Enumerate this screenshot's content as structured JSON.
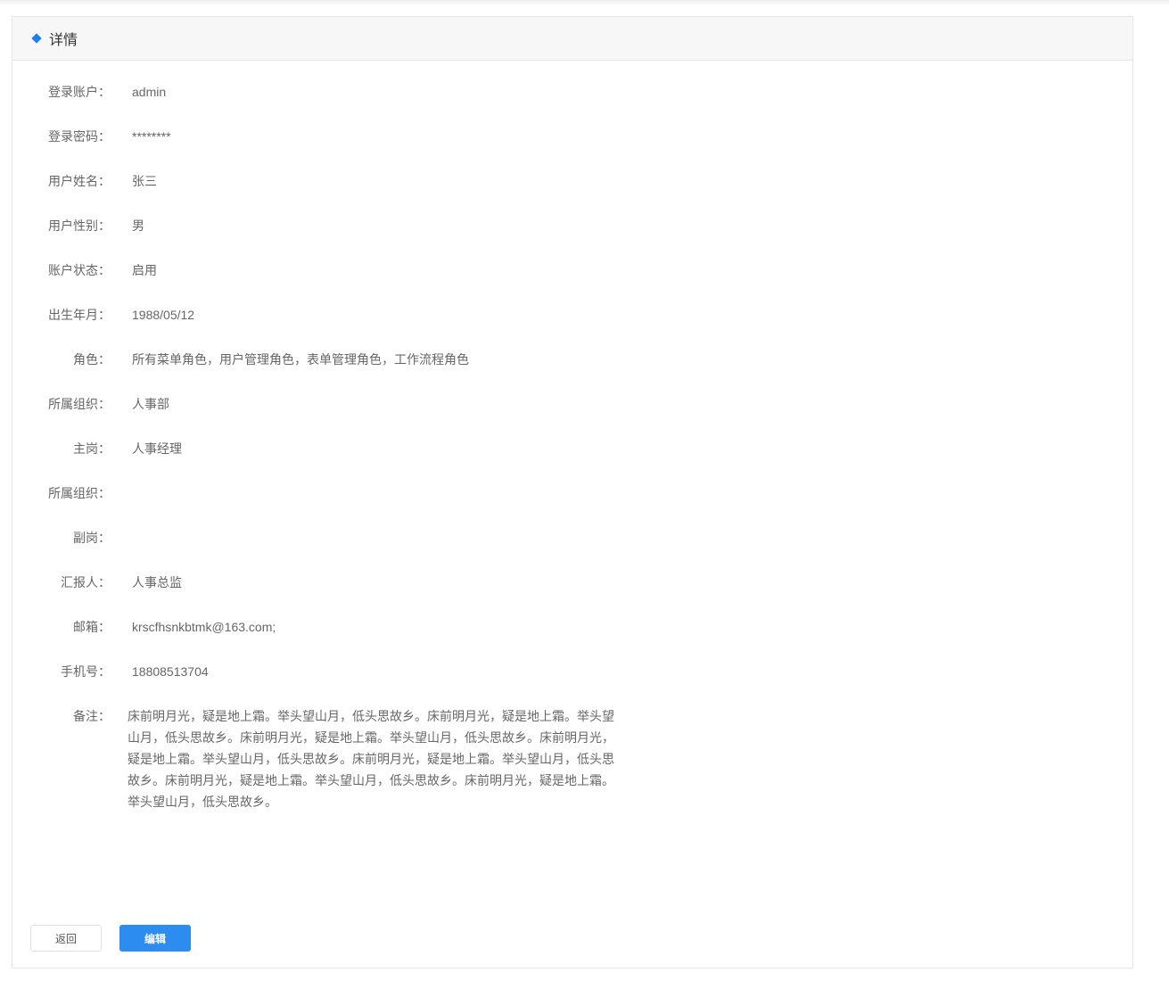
{
  "header": {
    "title": "详情",
    "icon": "diamond-icon",
    "accent_color": "#1c7ef0"
  },
  "fields": [
    {
      "label": "登录账户：",
      "value": "admin"
    },
    {
      "label": "登录密码：",
      "value": "********"
    },
    {
      "label": "用户姓名：",
      "value": "张三"
    },
    {
      "label": "用户性别：",
      "value": "男"
    },
    {
      "label": "账户状态：",
      "value": "启用"
    },
    {
      "label": "出生年月：",
      "value": "1988/05/12"
    },
    {
      "label": "角色：",
      "value": "所有菜单角色，用户管理角色，表单管理角色，工作流程角色"
    },
    {
      "label": "所属组织：",
      "value": "人事部"
    },
    {
      "label": "主岗：",
      "value": "人事经理"
    },
    {
      "label": "所属组织：",
      "value": ""
    },
    {
      "label": "副岗：",
      "value": ""
    },
    {
      "label": "汇报人：",
      "value": "人事总监"
    },
    {
      "label": "邮箱：",
      "value": "krscfhsnkbtmk@163.com;"
    },
    {
      "label": "手机号：",
      "value": "18808513704"
    }
  ],
  "remark": {
    "label": "备注：",
    "value": "床前明月光，疑是地上霜。举头望山月，低头思故乡。床前明月光，疑是地上霜。举头望山月，低头思故乡。床前明月光，疑是地上霜。举头望山月，低头思故乡。床前明月光，疑是地上霜。举头望山月，低头思故乡。床前明月光，疑是地上霜。举头望山月，低头思故乡。床前明月光，疑是地上霜。举头望山月，低头思故乡。床前明月光，疑是地上霜。举头望山月，低头思故乡。"
  },
  "actions": {
    "back_label": "返回",
    "edit_label": "编辑",
    "edit_color": "#2d8cf0"
  }
}
